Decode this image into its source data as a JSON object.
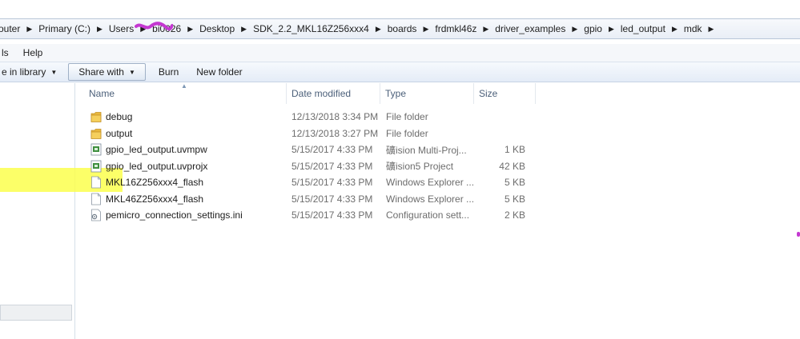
{
  "address_bar": {
    "crumbs": [
      "outer",
      "Primary (C:)",
      "Users",
      "bi0026",
      "Desktop",
      "SDK_2.2_MKL16Z256xxx4",
      "boards",
      "frdmkl46z",
      "driver_examples",
      "gpio",
      "led_output",
      "mdk"
    ]
  },
  "menu": {
    "items": [
      "ls",
      "Help"
    ]
  },
  "toolbar": {
    "include_label": "e in library",
    "share_label": "Share with",
    "burn_label": "Burn",
    "new_folder_label": "New folder"
  },
  "columns": {
    "name": "Name",
    "date": "Date modified",
    "type": "Type",
    "size": "Size"
  },
  "files": [
    {
      "name": "debug",
      "date": "12/13/2018 3:34 PM",
      "type": "File folder",
      "size": "",
      "icon": "folder-icon"
    },
    {
      "name": "output",
      "date": "12/13/2018 3:27 PM",
      "type": "File folder",
      "size": "",
      "icon": "folder-icon"
    },
    {
      "name": "gpio_led_output.uvmpw",
      "date": "5/15/2017 4:33 PM",
      "type": "礦ision Multi-Proj...",
      "size": "1 KB",
      "icon": "uvision-file-icon"
    },
    {
      "name": "gpio_led_output.uvprojx",
      "date": "5/15/2017 4:33 PM",
      "type": "礦ision5 Project",
      "size": "42 KB",
      "icon": "uvision-file-icon"
    },
    {
      "name": "MKL16Z256xxx4_flash",
      "date": "5/15/2017 4:33 PM",
      "type": "Windows Explorer ...",
      "size": "5 KB",
      "icon": "blank-file-icon"
    },
    {
      "name": "MKL46Z256xxx4_flash",
      "date": "5/15/2017 4:33 PM",
      "type": "Windows Explorer ...",
      "size": "5 KB",
      "icon": "blank-file-icon"
    },
    {
      "name": "pemicro_connection_settings.ini",
      "date": "5/15/2017 4:33 PM",
      "type": "Configuration sett...",
      "size": "2 KB",
      "icon": "settings-file-icon"
    }
  ],
  "colors": {
    "highlight": "#fbff4d",
    "scribble": "#c438d1",
    "folder": "#e8b73c"
  }
}
